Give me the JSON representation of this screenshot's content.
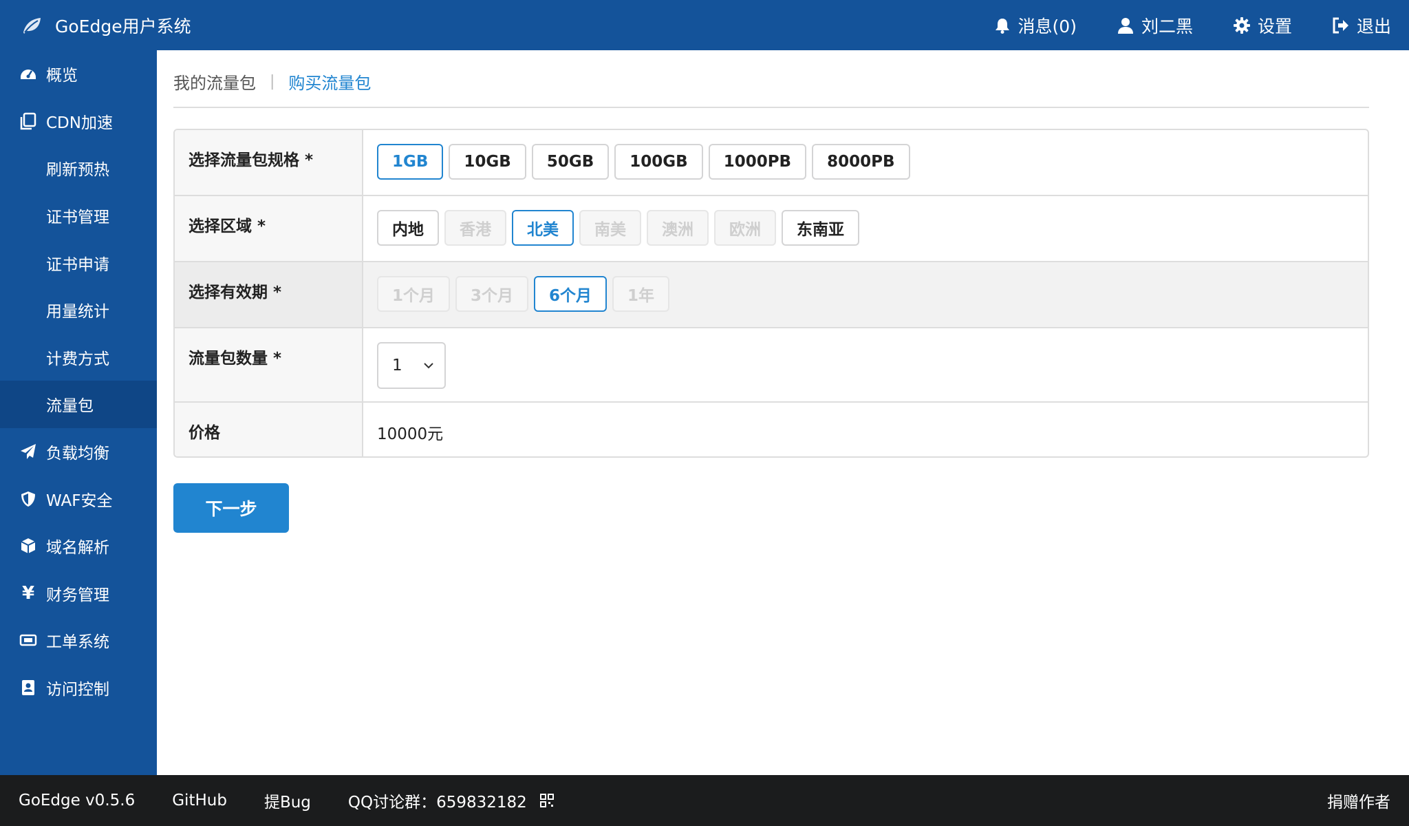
{
  "header": {
    "brand": "GoEdge用户系统",
    "messages": "消息(0)",
    "user": "刘二黑",
    "settings": "设置",
    "logout": "退出"
  },
  "sidebar": {
    "items": [
      {
        "label": "概览",
        "icon": "dashboard-icon"
      },
      {
        "label": "CDN加速",
        "icon": "copy-icon"
      },
      {
        "label": "刷新预热"
      },
      {
        "label": "证书管理"
      },
      {
        "label": "证书申请"
      },
      {
        "label": "用量统计"
      },
      {
        "label": "计费方式"
      },
      {
        "label": "流量包",
        "active": true
      },
      {
        "label": "负载均衡",
        "icon": "paper-plane-icon"
      },
      {
        "label": "WAF安全",
        "icon": "shield-icon"
      },
      {
        "label": "域名解析",
        "icon": "cube-icon"
      },
      {
        "label": "财务管理",
        "icon": "yen-icon",
        "glyph": "¥"
      },
      {
        "label": "工单系统",
        "icon": "ticket-icon"
      },
      {
        "label": "访问控制",
        "icon": "address-book-icon"
      }
    ]
  },
  "tabs": {
    "my_packages": "我的流量包",
    "separator": "|",
    "buy_packages": "购买流量包"
  },
  "form": {
    "spec_label": "选择流量包规格 *",
    "specs": [
      "1GB",
      "10GB",
      "50GB",
      "100GB",
      "1000PB",
      "8000PB"
    ],
    "selected_spec": "1GB",
    "region_label": "选择区域 *",
    "regions": [
      "内地",
      "香港",
      "北美",
      "南美",
      "澳洲",
      "欧洲",
      "东南亚"
    ],
    "selected_region": "北美",
    "period_label": "选择有效期 *",
    "periods": [
      "1个月",
      "3个月",
      "6个月",
      "1年"
    ],
    "selected_period": "6个月",
    "quantity_label": "流量包数量 *",
    "quantity_value": "1",
    "price_label": "价格",
    "price_value": "10000元"
  },
  "next_button": "下一步",
  "footer": {
    "version": "GoEdge v0.5.6",
    "github": "GitHub",
    "bug": "提Bug",
    "qq_group": "QQ讨论群：659832182",
    "donate": "捐赠作者"
  },
  "colors": {
    "header_bg": "#14539a",
    "sidebar_bg": "#14539a",
    "sidebar_active_bg": "#0f4686",
    "accent": "#2185d0",
    "footer_bg": "#1b1c1d"
  }
}
